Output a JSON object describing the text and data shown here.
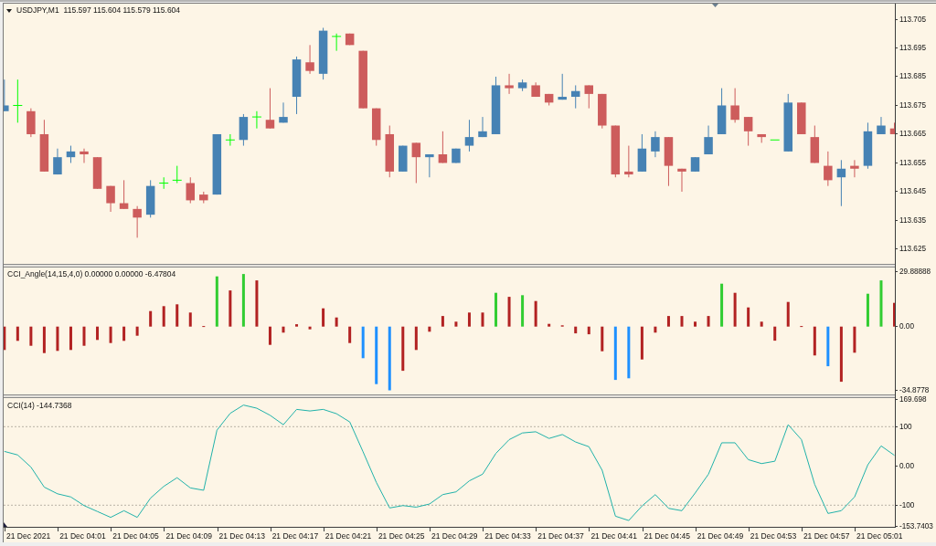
{
  "panes": [
    {
      "title": "USDJPY,M1",
      "quote": "115.597 115.604 115.579 115.604",
      "chart_data": {
        "type": "candlestick",
        "ylim": [
          113.6199,
          113.7104
        ],
        "yticks": [
          {
            "value": 113.705,
            "label": "113.705"
          },
          {
            "value": 113.695,
            "label": "113.695"
          },
          {
            "value": 113.685,
            "label": "113.685"
          },
          {
            "value": 113.675,
            "label": "113.675"
          },
          {
            "value": 113.665,
            "label": "113.665"
          },
          {
            "value": 113.655,
            "label": "113.655"
          },
          {
            "value": 113.645,
            "label": "113.645"
          },
          {
            "value": 113.635,
            "label": "113.635"
          },
          {
            "value": 113.625,
            "label": "113.625"
          }
        ],
        "ohlc": [
          [
            113.673,
            113.684,
            113.673,
            113.675
          ],
          [
            113.675,
            113.684,
            113.669,
            113.675
          ],
          [
            113.673,
            113.674,
            113.664,
            113.665
          ],
          [
            113.665,
            113.67,
            113.652,
            113.652
          ],
          [
            113.651,
            113.66,
            113.651,
            113.657
          ],
          [
            113.657,
            113.661,
            113.655,
            113.659
          ],
          [
            113.659,
            113.66,
            113.655,
            113.658
          ],
          [
            113.657,
            113.657,
            113.646,
            113.646
          ],
          [
            113.647,
            113.647,
            113.638,
            113.641
          ],
          [
            113.641,
            113.649,
            113.639,
            113.639
          ],
          [
            113.639,
            113.64,
            113.629,
            113.636
          ],
          [
            113.637,
            113.649,
            113.636,
            113.647
          ],
          [
            113.648,
            113.65,
            113.646,
            113.648
          ],
          [
            113.649,
            113.654,
            113.648,
            113.649
          ],
          [
            113.648,
            113.65,
            113.641,
            113.642
          ],
          [
            113.644,
            113.645,
            113.641,
            113.642
          ],
          [
            113.644,
            113.665,
            113.644,
            113.665
          ],
          [
            113.663,
            113.665,
            113.661,
            113.663
          ],
          [
            113.663,
            113.672,
            113.661,
            113.671
          ],
          [
            113.671,
            113.673,
            113.667,
            113.671
          ],
          [
            113.67,
            113.681,
            113.667,
            113.667
          ],
          [
            113.669,
            113.676,
            113.669,
            113.671
          ],
          [
            113.678,
            113.692,
            113.672,
            113.691
          ],
          [
            113.69,
            113.696,
            113.686,
            113.687
          ],
          [
            113.686,
            113.702,
            113.684,
            113.701
          ],
          [
            113.699,
            113.7,
            113.694,
            113.699
          ],
          [
            113.7,
            113.7,
            113.696,
            113.696
          ],
          [
            113.694,
            113.694,
            113.674,
            113.674
          ],
          [
            113.674,
            113.674,
            113.661,
            113.663
          ],
          [
            113.665,
            113.668,
            113.65,
            113.652
          ],
          [
            113.652,
            113.661,
            113.652,
            113.661
          ],
          [
            113.662,
            113.662,
            113.648,
            113.657
          ],
          [
            113.657,
            113.658,
            113.65,
            113.658
          ],
          [
            113.658,
            113.666,
            113.655,
            113.655
          ],
          [
            113.655,
            113.66,
            113.655,
            113.66
          ],
          [
            113.661,
            113.67,
            113.659,
            113.664
          ],
          [
            113.664,
            113.671,
            113.664,
            113.666
          ],
          [
            113.665,
            113.685,
            113.665,
            113.682
          ],
          [
            113.682,
            113.686,
            113.679,
            113.681
          ],
          [
            113.681,
            113.684,
            113.68,
            113.683
          ],
          [
            113.682,
            113.683,
            113.678,
            113.678
          ],
          [
            113.679,
            113.679,
            113.675,
            113.676
          ],
          [
            113.677,
            113.686,
            113.677,
            113.678
          ],
          [
            113.678,
            113.682,
            113.674,
            113.68
          ],
          [
            113.682,
            113.682,
            113.674,
            113.679
          ],
          [
            113.679,
            113.679,
            113.667,
            113.668
          ],
          [
            113.668,
            113.668,
            113.65,
            113.651
          ],
          [
            113.652,
            113.661,
            113.65,
            113.651
          ],
          [
            113.652,
            113.665,
            113.652,
            113.66
          ],
          [
            113.659,
            113.666,
            113.657,
            113.664
          ],
          [
            113.664,
            113.664,
            113.647,
            113.654
          ],
          [
            113.653,
            113.653,
            113.645,
            113.652
          ],
          [
            113.652,
            113.657,
            113.652,
            113.657
          ],
          [
            113.658,
            113.668,
            113.658,
            113.664
          ],
          [
            113.665,
            113.681,
            113.665,
            113.675
          ],
          [
            113.675,
            113.681,
            113.669,
            113.67
          ],
          [
            113.671,
            113.671,
            113.661,
            113.666
          ],
          [
            113.665,
            113.665,
            113.662,
            113.664
          ],
          [
            113.663,
            113.663,
            113.663,
            113.663
          ],
          [
            113.659,
            113.679,
            113.659,
            113.676
          ],
          [
            113.676,
            113.676,
            113.665,
            113.665
          ],
          [
            113.664,
            113.668,
            113.655,
            113.655
          ],
          [
            113.654,
            113.659,
            113.647,
            113.649
          ],
          [
            113.65,
            113.656,
            113.64,
            113.653
          ],
          [
            113.654,
            113.656,
            113.65,
            113.653
          ],
          [
            113.654,
            113.669,
            113.653,
            113.666
          ],
          [
            113.665,
            113.671,
            113.665,
            113.668
          ],
          [
            113.667,
            113.669,
            113.665,
            113.665
          ]
        ]
      }
    },
    {
      "title": "CCI_Angle(14,15,4,0) 0.00000 0.00000 -6.47804",
      "chart_data": {
        "type": "bar",
        "ylim": [
          -37.15,
          32.35
        ],
        "yticks": [
          {
            "value": 29.88888,
            "label": "29.88888"
          },
          {
            "value": 0,
            "label": "0.00"
          },
          {
            "value": -34.8778,
            "label": "-34.8778"
          }
        ],
        "series": [
          {
            "color": "#32cd32",
            "values": [
              null,
              null,
              null,
              null,
              null,
              null,
              null,
              null,
              null,
              null,
              null,
              null,
              null,
              null,
              null,
              null,
              27.5,
              null,
              28.8,
              null,
              null,
              null,
              null,
              null,
              null,
              null,
              null,
              null,
              null,
              null,
              null,
              null,
              null,
              null,
              null,
              null,
              null,
              18.5,
              null,
              17.2,
              null,
              null,
              null,
              null,
              null,
              null,
              null,
              null,
              null,
              null,
              null,
              null,
              null,
              null,
              23.5,
              null,
              null,
              null,
              null,
              null,
              null,
              null,
              null,
              null,
              null,
              18.0,
              25.3,
              null
            ]
          },
          {
            "color": "#1e90ff",
            "values": [
              null,
              null,
              null,
              null,
              null,
              null,
              null,
              null,
              null,
              null,
              null,
              null,
              null,
              null,
              null,
              null,
              null,
              null,
              null,
              null,
              null,
              null,
              null,
              null,
              null,
              null,
              null,
              -17.3,
              -31.5,
              -34.9,
              null,
              null,
              null,
              null,
              null,
              null,
              null,
              null,
              null,
              null,
              null,
              null,
              null,
              null,
              null,
              null,
              -29.2,
              -28.3,
              null,
              null,
              null,
              null,
              null,
              null,
              null,
              null,
              null,
              null,
              null,
              null,
              null,
              null,
              -21.7,
              null,
              null,
              null,
              null,
              null
            ]
          },
          {
            "color": "#b22222",
            "values": [
              -12.8,
              -7.8,
              -10.5,
              -14.5,
              -13.3,
              -12.8,
              -10.5,
              -7.3,
              -9.0,
              -7.8,
              -5.0,
              8.5,
              11.2,
              12.2,
              7.7,
              0.3,
              null,
              19.8,
              null,
              25.3,
              -10.0,
              -3.3,
              1.3,
              -1.5,
              10.0,
              5.0,
              -9.0,
              null,
              null,
              null,
              -24.2,
              -12.8,
              -2.8,
              5.8,
              2.7,
              7.7,
              7.7,
              null,
              16.3,
              null,
              14.0,
              1.5,
              0.7,
              -3.7,
              -4.2,
              -13.5,
              null,
              null,
              -18.0,
              -3.3,
              5.8,
              5.8,
              2.7,
              5.8,
              null,
              18.5,
              10.5,
              2.7,
              -7.7,
              13.5,
              0.3,
              -15.8,
              null,
              -30.2,
              -14.3,
              null,
              null,
              13.0
            ]
          }
        ]
      }
    },
    {
      "title": "CCI(14) -144.7368",
      "chart_data": {
        "type": "line",
        "ylim": [
          -155.1,
          172.8
        ],
        "yticks": [
          {
            "value": 169.698,
            "label": "169.698"
          },
          {
            "value": 100,
            "label": "100"
          },
          {
            "value": 0,
            "label": "0.00"
          },
          {
            "value": -100,
            "label": "-100"
          },
          {
            "value": -153.7403,
            "label": "-153.7403"
          }
        ],
        "ref_lines": [
          {
            "axis": "y",
            "value": 100
          },
          {
            "axis": "y",
            "value": -100
          }
        ],
        "values": [
          37,
          28,
          -3,
          -54,
          -71,
          -79,
          -101,
          -116,
          -131,
          -114,
          -131,
          -82,
          -52,
          -30,
          -56,
          -62,
          91,
          134,
          155,
          147,
          129,
          105,
          144,
          140,
          144,
          133,
          112,
          36,
          -42,
          -107,
          -101,
          -105,
          -97,
          -73,
          -66,
          -38,
          -21,
          32,
          67,
          84,
          87,
          70,
          80,
          61,
          49,
          -11,
          -128,
          -139,
          -102,
          -73,
          -108,
          -114,
          -69,
          -21,
          59,
          59,
          16,
          6,
          12,
          105,
          67,
          -47,
          -121,
          -114,
          -79,
          3,
          51,
          27
        ]
      }
    }
  ],
  "time_axis": [
    "21 Dec 2021",
    "21 Dec 04:01",
    "21 Dec 04:05",
    "21 Dec 04:09",
    "21 Dec 04:13",
    "21 Dec 04:17",
    "21 Dec 04:21",
    "21 Dec 04:25",
    "21 Dec 04:29",
    "21 Dec 04:33",
    "21 Dec 04:37",
    "21 Dec 04:41",
    "21 Dec 04:45",
    "21 Dec 04:49",
    "21 Dec 04:53",
    "21 Dec 04:57",
    "21 Dec 05:01"
  ]
}
